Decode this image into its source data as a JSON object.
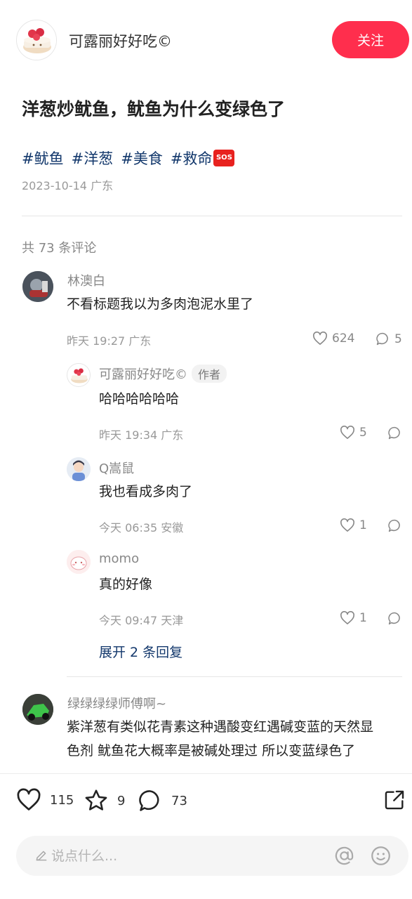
{
  "header": {
    "author_name": "可露丽好好吃©",
    "follow_label": "关注"
  },
  "post": {
    "title": "洋葱炒鱿鱼，鱿鱼为什么变绿色了",
    "tags": [
      "#鱿鱼",
      "#洋葱",
      "#美食",
      "#救命"
    ],
    "sos_badge": "SOS",
    "date": "2023-10-14",
    "location": "广东"
  },
  "comments_header": "共 73 条评论",
  "comments": [
    {
      "name": "林澳白",
      "text": "不看标题我以为多肉泡泥水里了",
      "time": "昨天 19:27",
      "location": "广东",
      "likes": "624",
      "replies": "5"
    },
    {
      "name": "可露丽好好吃©",
      "badge": "作者",
      "text": "哈哈哈哈哈哈",
      "time": "昨天 19:34",
      "location": "广东",
      "likes": "5"
    },
    {
      "name": "Q嵩鼠",
      "text": "我也看成多肉了",
      "time": "今天 06:35",
      "location": "安徽",
      "likes": "1"
    },
    {
      "name": "momo",
      "text": "真的好像",
      "time": "今天 09:47",
      "location": "天津",
      "likes": "1"
    },
    {
      "name": "绿绿绿绿师傅啊~",
      "text_line1": "紫洋葱有类似花青素这种遇酸变红遇碱变蓝的天然显",
      "text_line2": "色剂 鱿鱼花大概率是被碱处理过 所以变蓝绿色了"
    }
  ],
  "expand_replies": "展开 2 条回复",
  "bottom_bar": {
    "likes": "115",
    "collects": "9",
    "comments": "73",
    "input_placeholder": "说点什么..."
  },
  "icons": {
    "like": "heart-icon",
    "collect": "star-icon",
    "comment": "comment-bubble-icon",
    "share": "share-icon",
    "mention": "at-icon",
    "emoji": "smiley-icon",
    "pencil": "pencil-icon"
  },
  "colors": {
    "accent": "#ff2e4d",
    "tag": "#13386c",
    "muted": "#999999"
  }
}
